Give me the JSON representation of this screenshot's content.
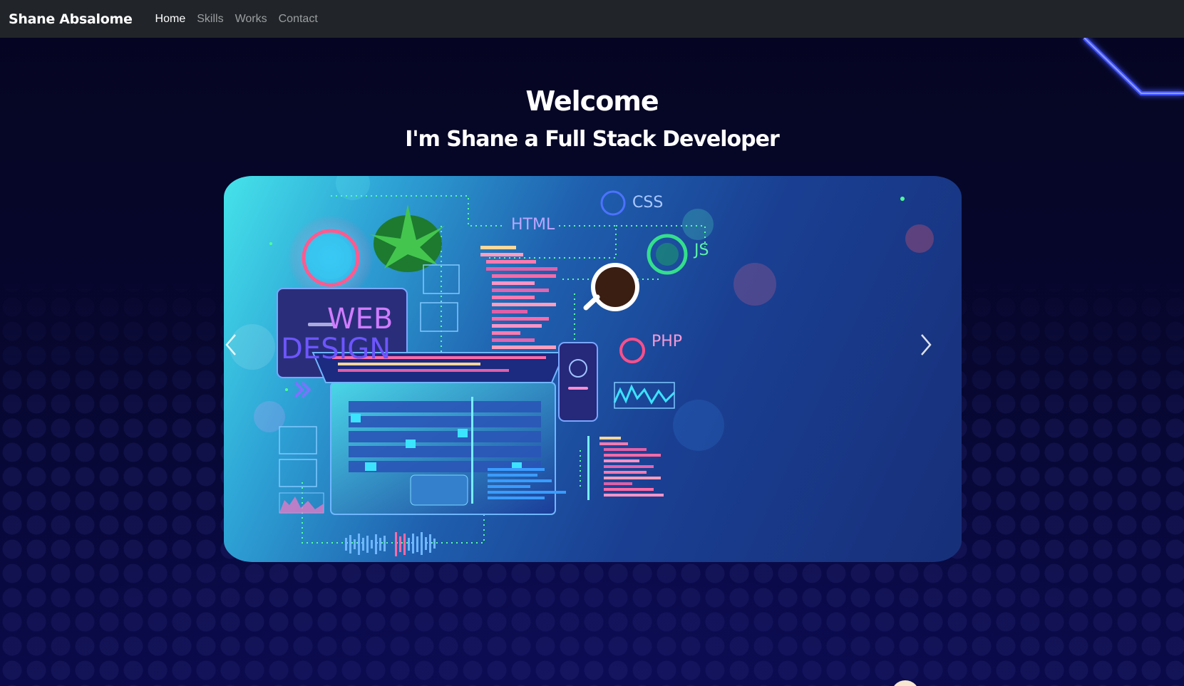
{
  "navbar": {
    "brand": "Shane Absalome",
    "links": [
      {
        "label": "Home",
        "active": true
      },
      {
        "label": "Skills",
        "active": false
      },
      {
        "label": "Works",
        "active": false
      },
      {
        "label": "Contact",
        "active": false
      }
    ]
  },
  "hero": {
    "title": "Welcome",
    "subtitle": "I'm Shane a Full Stack Developer"
  },
  "carousel": {
    "tags": {
      "css": "CSS",
      "html": "HTML",
      "js": "JS",
      "php": "PHP",
      "web": "WEB",
      "design": "DESIGN"
    },
    "prev_icon": "chevron-left-icon",
    "next_icon": "chevron-right-icon"
  },
  "colors": {
    "navbar_bg": "#212529",
    "page_bg": "#07072a",
    "accent_neon": "#3a4bff"
  }
}
